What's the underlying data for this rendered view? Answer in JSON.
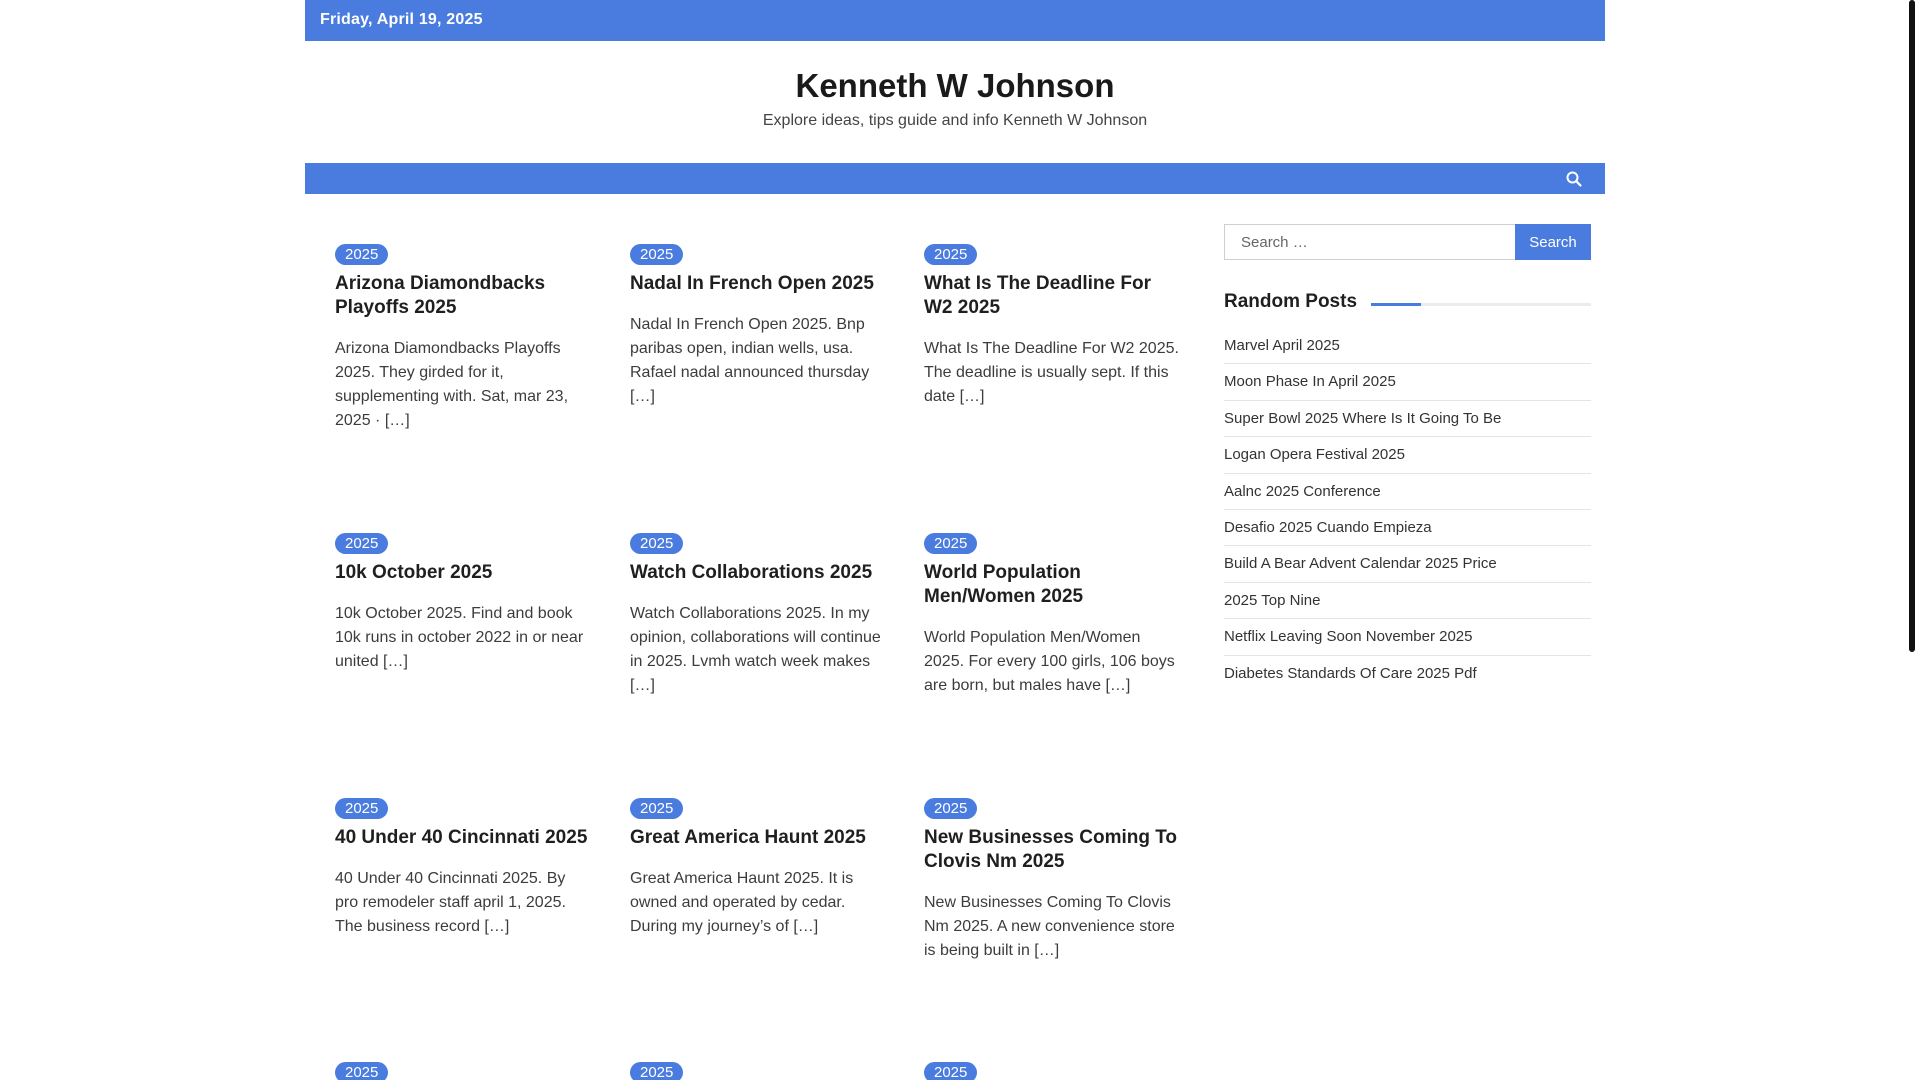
{
  "topbar": {
    "date": "Friday, April 19, 2025"
  },
  "site": {
    "title": "Kenneth W Johnson",
    "description": "Explore ideas, tips guide and info Kenneth W Johnson"
  },
  "nav": {
    "search_icon": "search-icon"
  },
  "posts": [
    {
      "category": "2025",
      "title": "Arizona Diamondbacks Playoffs 2025",
      "excerpt": "Arizona Diamondbacks Playoffs 2025. They girded for it, supplementing with. Sat, mar 23, 2025 · […]"
    },
    {
      "category": "2025",
      "title": "Nadal In French Open 2025",
      "excerpt": "Nadal In French Open 2025. Bnp paribas open, indian wells, usa. Rafael nadal announced thursday […]"
    },
    {
      "category": "2025",
      "title": "What Is The Deadline For W2 2025",
      "excerpt": "What Is The Deadline For W2 2025. The deadline is usually sept. If this date […]"
    },
    {
      "category": "2025",
      "title": "10k October 2025",
      "excerpt": "10k October 2025. Find and book 10k runs in october 2022 in or near united […]"
    },
    {
      "category": "2025",
      "title": "Watch Collaborations 2025",
      "excerpt": "Watch Collaborations 2025. In my opinion, collaborations will continue in 2025. Lvmh watch week makes […]"
    },
    {
      "category": "2025",
      "title": "World Population Men/Women 2025",
      "excerpt": "World Population Men/Women 2025. For every 100 girls, 106 boys are born, but males have […]"
    },
    {
      "category": "2025",
      "title": "40 Under 40 Cincinnati 2025",
      "excerpt": "40 Under 40 Cincinnati 2025. By pro remodeler staff april 1, 2025. The business record […]"
    },
    {
      "category": "2025",
      "title": "Great America Haunt 2025",
      "excerpt": "Great America Haunt 2025. It is owned and operated by cedar. During my journey’s of […]"
    },
    {
      "category": "2025",
      "title": "New Businesses Coming To Clovis Nm 2025",
      "excerpt": "New Businesses Coming To Clovis Nm 2025. A new convenience store is being built in […]"
    },
    {
      "category": "2025",
      "title": "",
      "excerpt": ""
    },
    {
      "category": "2025",
      "title": "",
      "excerpt": ""
    },
    {
      "category": "2025",
      "title": "",
      "excerpt": ""
    }
  ],
  "sidebar": {
    "search_placeholder": "Search …",
    "search_button": "Search",
    "random_title": "Random Posts",
    "random_posts": [
      "Marvel April 2025",
      "Moon Phase In April 2025",
      "Super Bowl 2025 Where Is It Going To Be",
      "Logan Opera Festival 2025",
      "Aalnc 2025 Conference",
      "Desafio 2025 Cuando Empieza",
      "Build A Bear Advent Calendar 2025 Price",
      "2025 Top Nine",
      "Netflix Leaving Soon November 2025",
      "Diabetes Standards Of Care 2025 Pdf"
    ]
  },
  "colors": {
    "accent": "#4a7bdf"
  }
}
